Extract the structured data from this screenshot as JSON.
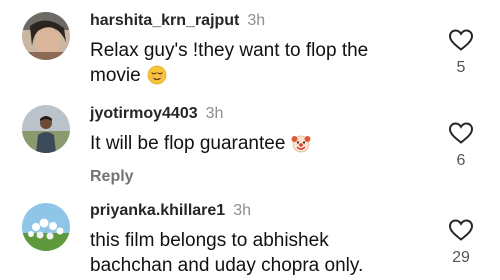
{
  "comments": [
    {
      "username": "harshita_krn_rajput",
      "time": "3h",
      "text_line1": "Relax guy's !they want to flop the",
      "text_line2": "movie",
      "emoji": "relieved-face-emoji",
      "like_count": "5"
    },
    {
      "username": "jyotirmoy4403",
      "time": "3h",
      "text": "It will be flop guarantee",
      "emoji": "clown-face-emoji",
      "reply_label": "Reply",
      "like_count": "6"
    },
    {
      "username": "priyanka.khillare1",
      "time": "3h",
      "text_line1": "this film belongs to abhishek",
      "text_line2": "bachchan and uday chopra only.",
      "like_count": "29"
    }
  ],
  "colors": {
    "username": "#262626",
    "timestamp": "#8e8e8e",
    "reply": "#737373",
    "heart_outline": "#262626"
  }
}
